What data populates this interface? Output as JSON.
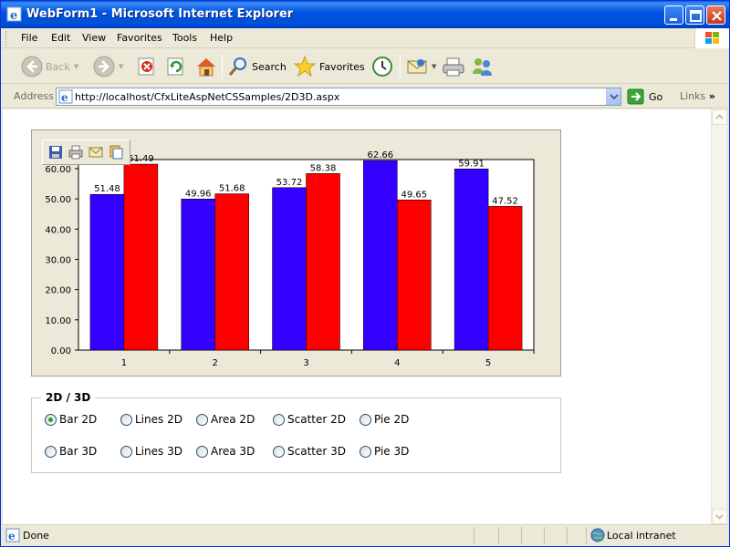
{
  "window": {
    "title": "WebForm1 - Microsoft Internet Explorer"
  },
  "menu": {
    "items": [
      "File",
      "Edit",
      "View",
      "Favorites",
      "Tools",
      "Help"
    ]
  },
  "toolbar": {
    "back_label": "Back",
    "search_label": "Search",
    "favorites_label": "Favorites"
  },
  "address": {
    "label": "Address",
    "url": "http://localhost/CfxLiteAspNetCSSamples/2D3D.aspx",
    "go_label": "Go",
    "links_label": "Links"
  },
  "chart_data": {
    "type": "bar",
    "categories": [
      "1",
      "2",
      "3",
      "4",
      "5"
    ],
    "series": [
      {
        "values": [
          51.48,
          49.96,
          53.72,
          62.66,
          59.91
        ],
        "color": "#3300ff"
      },
      {
        "values": [
          61.49,
          51.68,
          58.38,
          49.65,
          47.52
        ],
        "color": "#ff0000"
      }
    ],
    "data_labels": [
      "51.48",
      "61.49",
      "49.96",
      "51.68",
      "53.72",
      "58.38",
      "62.66",
      "49.65",
      "59.91",
      "47.52"
    ],
    "ylim": [
      0,
      63
    ],
    "yticks": [
      0,
      10,
      20,
      30,
      40,
      50,
      60
    ],
    "ytick_labels": [
      "0.00",
      "10.00",
      "20.00",
      "30.00",
      "40.00",
      "50.00",
      "60.00"
    ],
    "grid": false,
    "legend": "none"
  },
  "chart_toolbar": {
    "icons": [
      "save-icon",
      "print-icon",
      "email-icon",
      "copy-icon"
    ]
  },
  "options": {
    "legend": "2D / 3D",
    "row1": [
      "Bar 2D",
      "Lines 2D",
      "Area 2D",
      "Scatter 2D",
      "Pie 2D"
    ],
    "row2": [
      "Bar 3D",
      "Lines 3D",
      "Area 3D",
      "Scatter 3D",
      "Pie 3D"
    ],
    "selected": "Bar 2D"
  },
  "status": {
    "text": "Done",
    "zone": "Local intranet"
  }
}
